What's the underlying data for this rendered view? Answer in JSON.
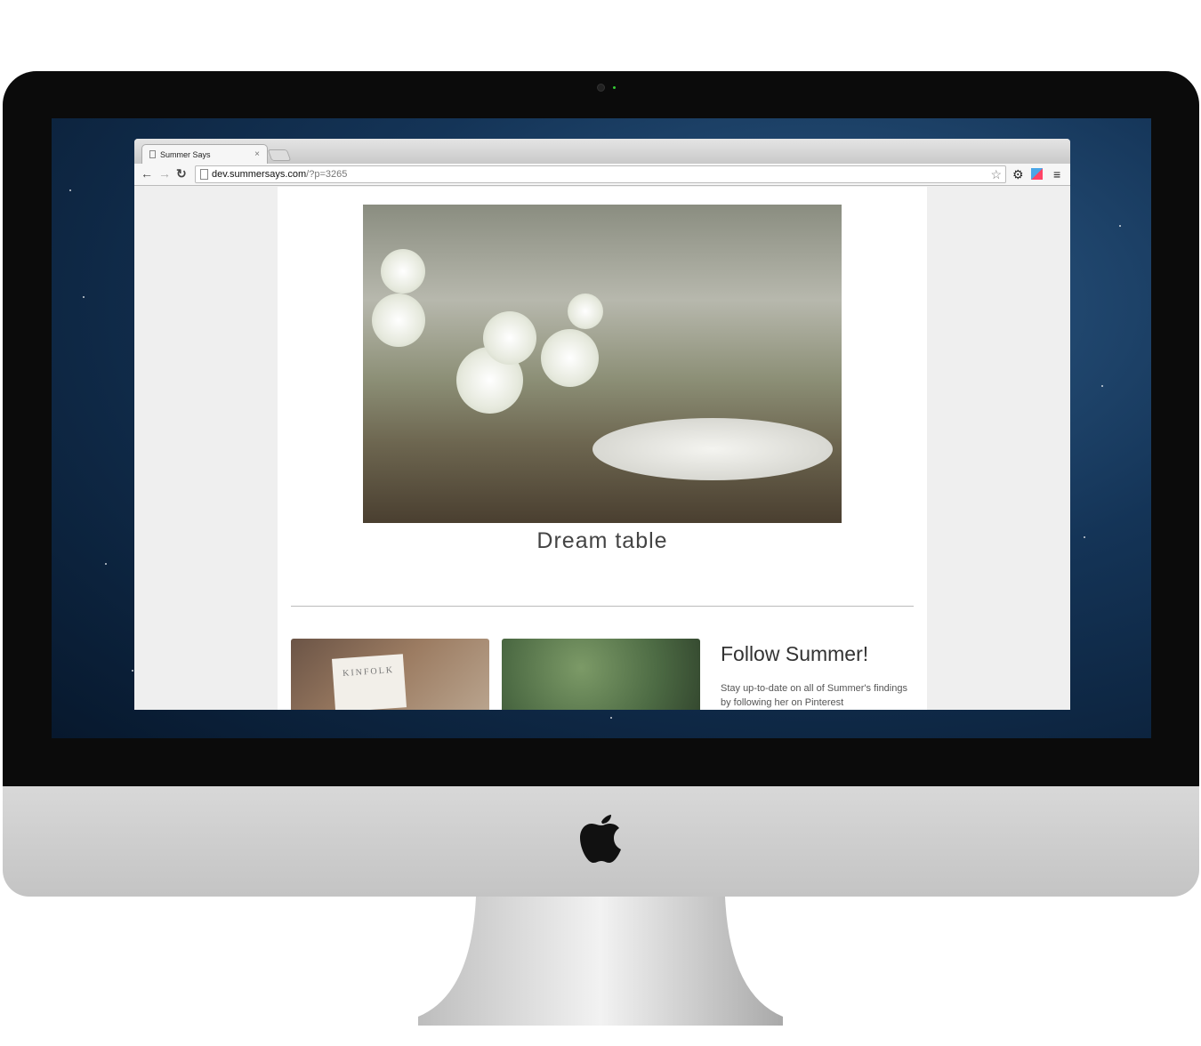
{
  "browser": {
    "tab_title": "Summer Says",
    "url_host": "dev.summersays.com",
    "url_path": "/?p=3265",
    "icons": [
      "back-icon",
      "forward-icon",
      "reload-icon",
      "page-icon",
      "star-icon",
      "gear-icon",
      "extension-icon",
      "menu-icon"
    ]
  },
  "page": {
    "post_title": "Dream table",
    "thumb_text": "KINFOLK",
    "follow_heading": "Follow Summer!",
    "follow_text": "Stay up-to-date on all of Summer's findings by following her on Pinterest"
  },
  "colors": {
    "bezel": "#0b0b0b",
    "chin": "#cfcfcf",
    "page_bg": "#efefef",
    "content_bg": "#ffffff"
  }
}
